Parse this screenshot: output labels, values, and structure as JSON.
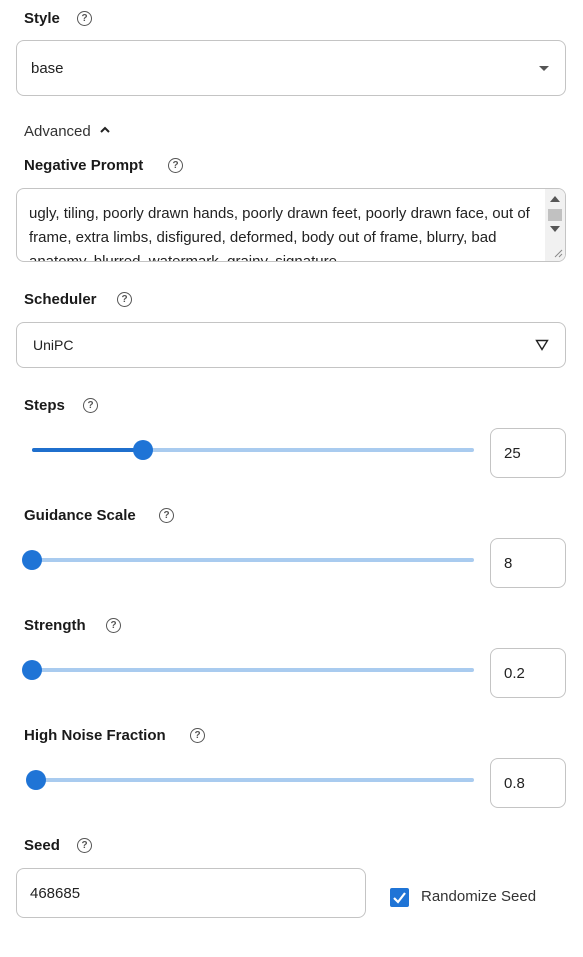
{
  "style": {
    "label": "Style",
    "help": "?",
    "value": "base"
  },
  "advanced": {
    "label": "Advanced",
    "chevron": "▲"
  },
  "negative_prompt": {
    "label": "Negative Prompt",
    "help": "?",
    "value": "ugly, tiling, poorly drawn hands, poorly drawn feet, poorly drawn face, out of frame, extra limbs, disfigured, deformed, body out of frame, blurry, bad anatomy, blurred, watermark, grainy, signature"
  },
  "scheduler": {
    "label": "Scheduler",
    "help": "?",
    "value": "UniPC"
  },
  "steps": {
    "label": "Steps",
    "help": "?",
    "value": "25",
    "fraction": 0.25
  },
  "guidance_scale": {
    "label": "Guidance Scale",
    "help": "?",
    "value": "8",
    "fraction": 0.0
  },
  "strength": {
    "label": "Strength",
    "help": "?",
    "value": "0.2",
    "fraction": 0.0
  },
  "high_noise_fraction": {
    "label": "High Noise Fraction",
    "help": "?",
    "value": "0.8",
    "fraction": 0.01
  },
  "seed": {
    "label": "Seed",
    "help": "?",
    "value": "468685",
    "randomize_label": "Randomize Seed",
    "randomize_checked": true
  },
  "colors": {
    "accent": "#1f74d6",
    "track": "#a9cbef",
    "border": "#c4c4c4"
  }
}
